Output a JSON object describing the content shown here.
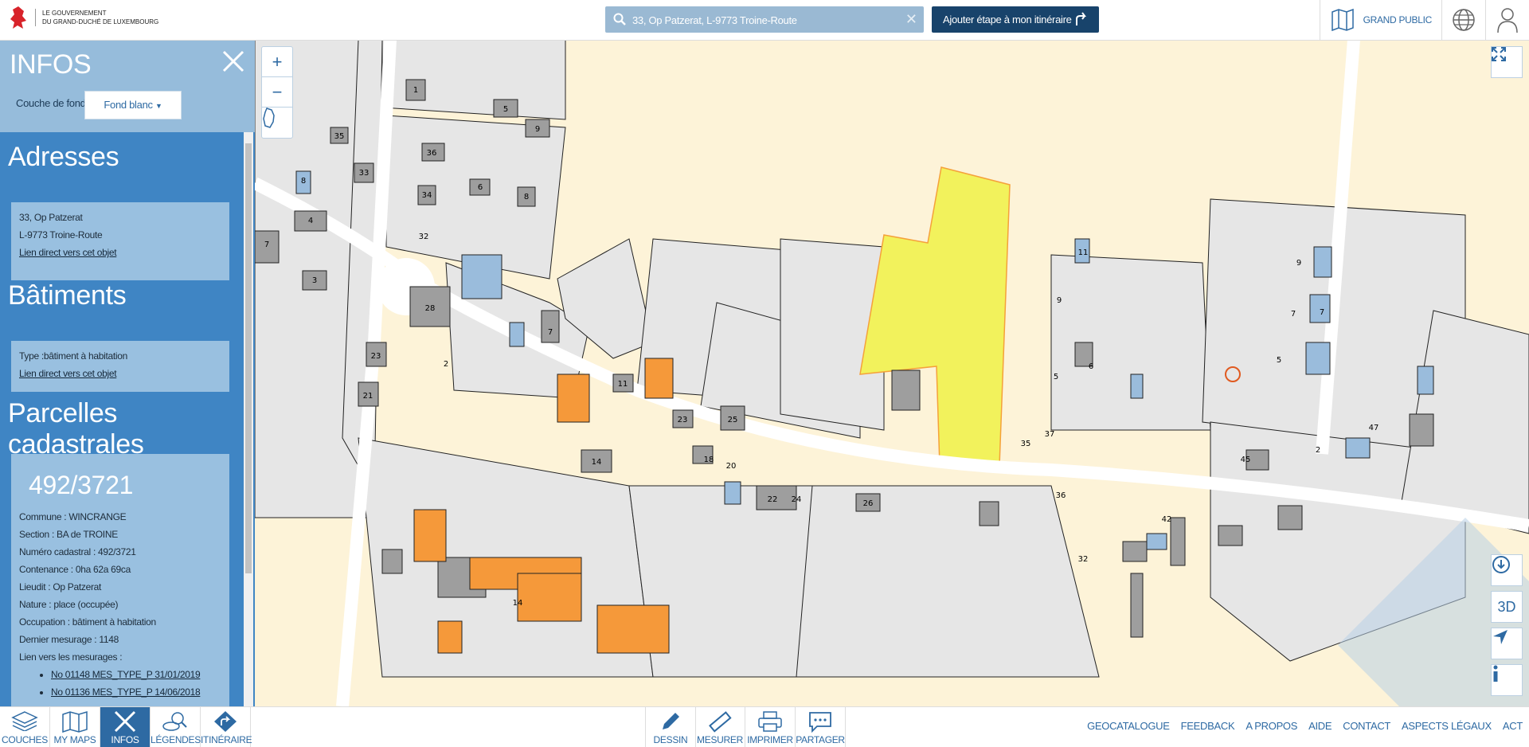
{
  "header": {
    "logo_line1": "Le Gouvernement",
    "logo_line2": "du Grand-Duché de Luxembourg",
    "search_value": "33, Op Patzerat, L-9773 Troine-Route",
    "clear_glyph": "✕",
    "add_step_label": "Ajouter étape à mon itinéraire",
    "grand_public_label": "GRAND PUBLIC"
  },
  "panel": {
    "title": "INFOS",
    "background_label": "Couche de fond:",
    "background_value": "Fond blanc",
    "addresses": {
      "title": "Adresses",
      "line1": "33, Op Patzerat",
      "line2": "L-9773 Troine-Route",
      "link": "Lien direct vers cet objet"
    },
    "buildings": {
      "title": "Bâtiments",
      "type": "Type :bâtiment à habitation",
      "link": "Lien direct vers cet objet"
    },
    "parcels": {
      "title": "Parcelles cadastrales",
      "number": "492/3721",
      "commune": "Commune : WINCRANGE",
      "section": "Section : BA de TROINE",
      "numero": "Numéro cadastral : 492/3721",
      "contenance": "Contenance : 0ha 62a 69ca",
      "lieudit": "Lieudit : Op Patzerat",
      "nature": "Nature : place (occupée)",
      "occupation": "Occupation : bâtiment à habitation",
      "dernier": "Dernier mesurage : 1148",
      "lien_mesurages": "Lien vers les mesurages :",
      "mesurages": [
        "No 01148 MES_TYPE_P 31/01/2019",
        "No 01136 MES_TYPE_P 14/06/2018"
      ]
    }
  },
  "map": {
    "zoom_in": "+",
    "zoom_out": "−",
    "btn_3d": "3D",
    "colors": {
      "background": "#fdf3d8",
      "parcel": "#e6e6e6",
      "building": "#9e9e9e",
      "highlight": "#f2f25c",
      "orange": "#f5993a",
      "blue_building": "#9abcdc"
    },
    "house_numbers": [
      "1",
      "5",
      "9",
      "35",
      "36",
      "6",
      "8",
      "33",
      "34",
      "32",
      "8",
      "4",
      "7",
      "3",
      "28",
      "7",
      "23",
      "21",
      "2",
      "11",
      "23",
      "25",
      "14",
      "18",
      "20",
      "22",
      "24",
      "26",
      "36",
      "32",
      "42",
      "11",
      "9",
      "7",
      "6",
      "5",
      "9",
      "7",
      "5",
      "2",
      "45",
      "47",
      "35",
      "37",
      "14"
    ]
  },
  "footer": {
    "tabs": [
      "COUCHES",
      "MY MAPS",
      "INFOS",
      "LÉGENDES",
      "ITINÉRAIRE"
    ],
    "tools": [
      "DESSIN",
      "MESURER",
      "IMPRIMER",
      "PARTAGER"
    ],
    "links": [
      "GEOCATALOGUE",
      "FEEDBACK",
      "A PROPOS",
      "AIDE",
      "CONTACT",
      "ASPECTS LÉGAUX",
      "ACT"
    ]
  }
}
